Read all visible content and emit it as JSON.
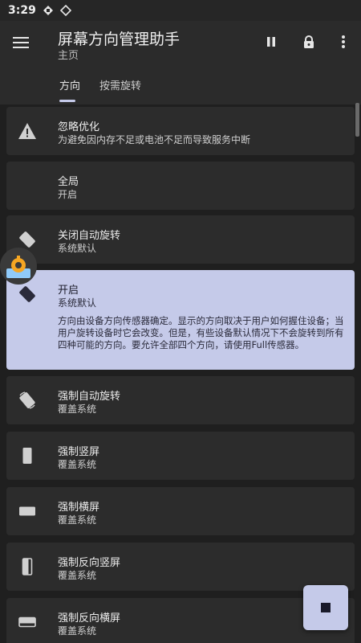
{
  "status": {
    "time": "3:29"
  },
  "appbar": {
    "title": "屏幕方向管理助手",
    "subtitle": "主页"
  },
  "tabs": [
    {
      "label": "方向"
    },
    {
      "label": "按需旋转"
    }
  ],
  "items": [
    {
      "title": "忽略优化",
      "subtitle": "为避免因内存不足或电池不足而导致服务中断",
      "icon": "warning-icon"
    },
    {
      "title": "全局",
      "subtitle": "开启",
      "icon": ""
    },
    {
      "title": "关闭自动旋转",
      "subtitle": "系统默认",
      "icon": "rotate-off-icon"
    },
    {
      "title": "开启",
      "subtitle": "系统默认",
      "icon": "rotate-on-icon",
      "selected": true,
      "description": "方向由设备方向传感器确定。显示的方向取决于用户如何握住设备；当用户旋转设备时它会改变。但是，有些设备默认情况下不会旋转到所有四种可能的方向。要允许全部四个方向，请使用Full传感器。"
    },
    {
      "title": "强制自动旋转",
      "subtitle": "覆盖系统",
      "icon": "force-rotate-icon"
    },
    {
      "title": "强制竖屏",
      "subtitle": "覆盖系统",
      "icon": "portrait-icon"
    },
    {
      "title": "强制横屏",
      "subtitle": "覆盖系统",
      "icon": "landscape-icon"
    },
    {
      "title": "强制反向竖屏",
      "subtitle": "覆盖系统",
      "icon": "reverse-portrait-icon"
    },
    {
      "title": "强制反向横屏",
      "subtitle": "覆盖系统",
      "icon": "reverse-landscape-icon"
    }
  ],
  "colors": {
    "accent": "#c5cae9",
    "card": "#2c2c2c",
    "background": "#1f1f1f"
  }
}
